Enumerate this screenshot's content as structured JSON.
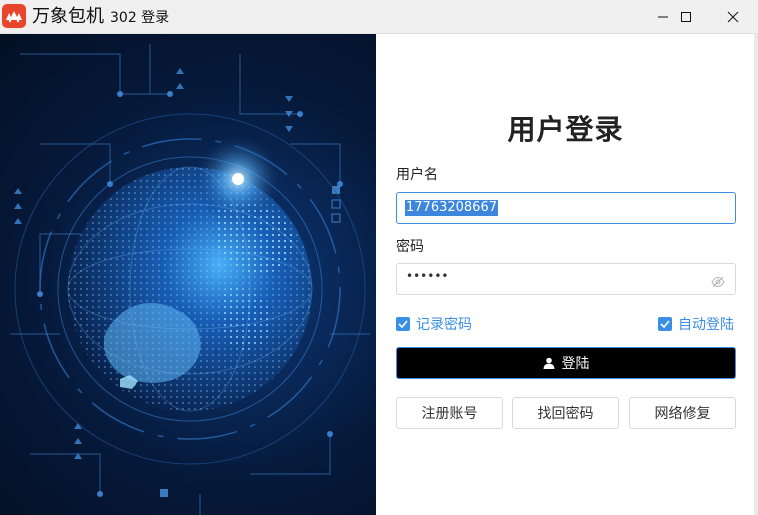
{
  "window": {
    "app_name": "万象包机",
    "subtitle": "302 登录",
    "controls": [
      "minimize-icon",
      "maximize-icon",
      "close-icon"
    ]
  },
  "login": {
    "title": "用户登录",
    "username_label": "用户名",
    "username_value": "17763208667",
    "password_label": "密码",
    "password_masked": "••••••",
    "remember_label": "记录密码",
    "remember_checked": true,
    "auto_login_label": "自动登陆",
    "auto_login_checked": true,
    "submit_label": "登陆",
    "secondary_buttons": [
      "注册账号",
      "找回密码",
      "网络修复"
    ]
  },
  "colors": {
    "accent": "#3a8ee6",
    "submit_bg": "#000000",
    "logo_bg": "#e8452c"
  }
}
